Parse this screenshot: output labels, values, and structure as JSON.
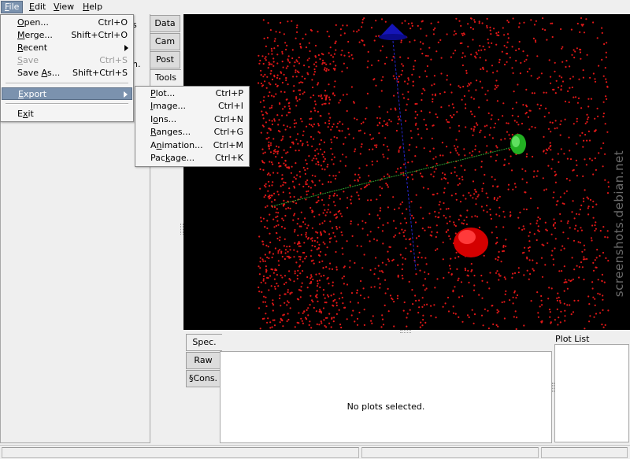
{
  "menubar": {
    "items": [
      {
        "label": "File",
        "mnemonic": "F",
        "rest": "ile"
      },
      {
        "label": "Edit",
        "mnemonic": "E",
        "rest": "dit"
      },
      {
        "label": "View",
        "mnemonic": "V",
        "rest": "iew"
      },
      {
        "label": "Help",
        "mnemonic": "H",
        "rest": "elp"
      }
    ]
  },
  "file_menu": {
    "open": {
      "pre": "",
      "m": "O",
      "post": "pen...",
      "shortcut": "Ctrl+O"
    },
    "merge": {
      "pre": "",
      "m": "M",
      "post": "erge...",
      "shortcut": "Shift+Ctrl+O"
    },
    "recent": {
      "pre": "",
      "m": "R",
      "post": "ecent"
    },
    "save": {
      "pre": "",
      "m": "S",
      "post": "ave",
      "shortcut": "Ctrl+S"
    },
    "save_as": {
      "pre": "Save ",
      "m": "A",
      "post": "s...",
      "shortcut": "Shift+Ctrl+S"
    },
    "export": {
      "pre": "",
      "m": "E",
      "post": "xport"
    },
    "exit": {
      "pre": "E",
      "m": "x",
      "post": "it"
    }
  },
  "export_menu": {
    "plot": {
      "pre": "",
      "m": "P",
      "post": "lot...",
      "shortcut": "Ctrl+P"
    },
    "image": {
      "pre": "",
      "m": "I",
      "post": "mage...",
      "shortcut": "Ctrl+I"
    },
    "ions": {
      "pre": "I",
      "m": "o",
      "post": "ns...",
      "shortcut": "Ctrl+N"
    },
    "ranges": {
      "pre": "",
      "m": "R",
      "post": "anges...",
      "shortcut": "Ctrl+G"
    },
    "animation": {
      "pre": "A",
      "m": "n",
      "post": "imation...",
      "shortcut": "Ctrl+M"
    },
    "package": {
      "pre": "Pac",
      "m": "k",
      "post": "age...",
      "shortcut": "Ctrl+K"
    }
  },
  "sidebar_tabs": [
    "Data",
    "Cam",
    "Post",
    "Tools"
  ],
  "sidebar_fragments": {
    "a": "s",
    "b": "n."
  },
  "bottom_tabs": [
    "Spec.",
    "Raw",
    "§Cons."
  ],
  "spec": {
    "message": "No plots selected."
  },
  "plot_list": {
    "label": "Plot List"
  },
  "watermark": "screenshots.debian.net",
  "colors": {
    "background": "#000000",
    "points": "#e01818",
    "x_axis": "#2fa02f",
    "z_axis": "#2626c8",
    "y_axis_marker": "#d40000",
    "selection": "#7b92ae"
  },
  "scene": {
    "point_count": 2400,
    "seed": 7
  }
}
